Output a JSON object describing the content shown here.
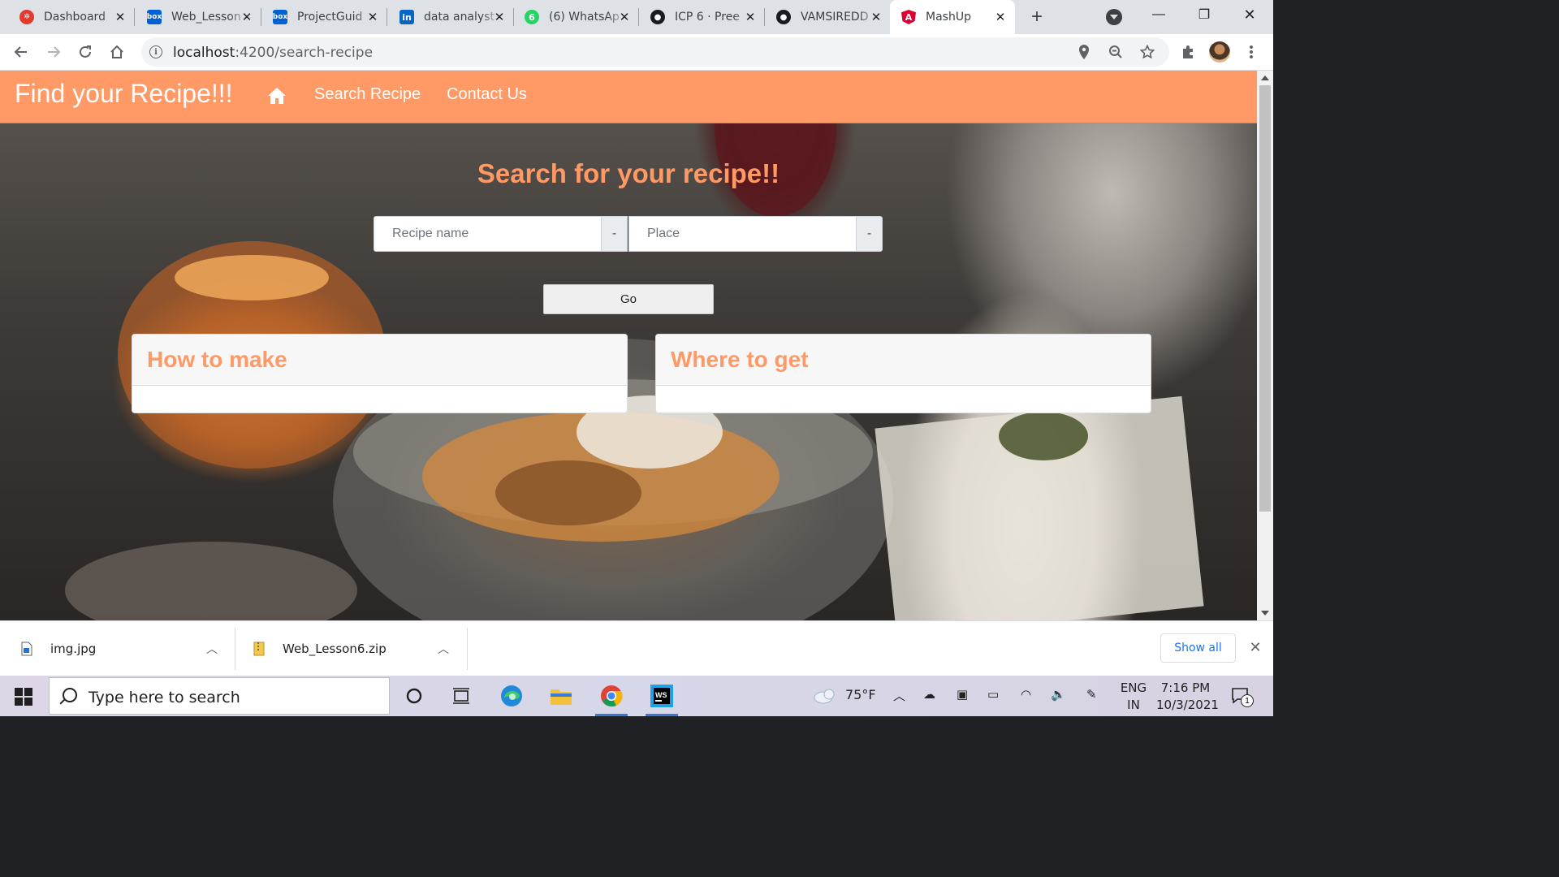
{
  "browser": {
    "tabs": [
      {
        "title": "Dashboard",
        "icon": "canvas-icon",
        "color": "#e03b2d"
      },
      {
        "title": "Web_Lesson",
        "icon": "box-icon",
        "color": "#0061d5"
      },
      {
        "title": "ProjectGuid",
        "icon": "box-icon",
        "color": "#0061d5"
      },
      {
        "title": "data analyst",
        "icon": "linkedin-icon",
        "color": "#0a66c2"
      },
      {
        "title": "(6) WhatsAp",
        "icon": "whatsapp-icon",
        "color": "#25d366"
      },
      {
        "title": "ICP 6 · Pree",
        "icon": "github-icon",
        "color": "#161b22"
      },
      {
        "title": "VAMSIREDD",
        "icon": "github-icon",
        "color": "#161b22"
      },
      {
        "title": "MashUp",
        "icon": "angular-icon",
        "color": "#dd0031",
        "active": true
      }
    ],
    "whatsapp_badge": "6",
    "url_host": "localhost",
    "url_path": ":4200/search-recipe"
  },
  "navbar": {
    "brand": "Find your Recipe!!!",
    "links": [
      "Search Recipe",
      "Contact Us"
    ],
    "color": "#ff9966"
  },
  "search": {
    "heading": "Search for your recipe!!",
    "recipe_placeholder": "Recipe name",
    "place_placeholder": "Place",
    "addon_label": "-",
    "go_label": "Go"
  },
  "cards": {
    "how": "How to make",
    "where": "Where to get"
  },
  "downloads": {
    "items": [
      "img.jpg",
      "Web_Lesson6.zip"
    ],
    "show_all": "Show all"
  },
  "taskbar": {
    "search_text": "Type here to search",
    "temperature": "75°F",
    "lang_top": "ENG",
    "lang_bottom": "IN",
    "time": "7:16 PM",
    "date": "10/3/2021",
    "notification_count": "1"
  }
}
